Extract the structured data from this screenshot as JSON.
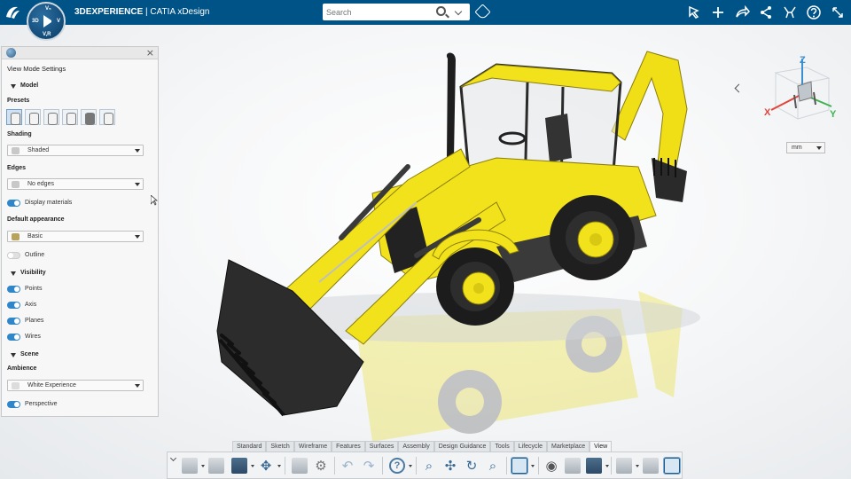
{
  "app": {
    "brand_bold": "3DEXPERIENCE",
    "brand_rest": " | CATIA  xDesign",
    "search_placeholder": "Search",
    "compass_labels": [
      "V₅",
      "3D",
      "V",
      "V,R"
    ]
  },
  "panel": {
    "title": "View Mode Settings",
    "sections": {
      "model": "Model",
      "visibility": "Visibility",
      "scene": "Scene"
    },
    "labels": {
      "presets": "Presets",
      "shading": "Shading",
      "edges": "Edges",
      "default_appearance": "Default appearance",
      "ambience": "Ambience"
    },
    "dropdowns": {
      "shading": "Shaded",
      "edges": "No edges",
      "default_appearance": "Basic",
      "ambience": "White Experience"
    },
    "toggles": [
      {
        "label": "Display materials",
        "on": true
      },
      {
        "label": "Outline",
        "on": false
      },
      {
        "label": "Points",
        "on": true
      },
      {
        "label": "Axis",
        "on": true
      },
      {
        "label": "Planes",
        "on": true
      },
      {
        "label": "Wires",
        "on": true
      },
      {
        "label": "Perspective",
        "on": true
      }
    ]
  },
  "viewport": {
    "units": "mm",
    "axes": {
      "x": "X",
      "y": "Y",
      "z": "Z"
    }
  },
  "toolbar": {
    "tabs": [
      "Standard",
      "Sketch",
      "Wireframe",
      "Features",
      "Surfaces",
      "Assembly",
      "Design Guidance",
      "Tools",
      "Lifecycle",
      "Marketplace",
      "View"
    ],
    "active_tab": "View"
  },
  "colors": {
    "topbar": "#005386",
    "accent": "#2f87c9",
    "machine_yellow": "#f2e21c"
  }
}
